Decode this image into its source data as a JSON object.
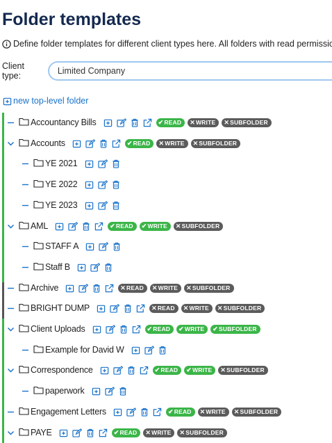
{
  "header": {
    "title": "Folder templates",
    "description": "Define folder templates for different client types here. All folders with read permissio"
  },
  "client_type": {
    "label": "Client type:",
    "value": "Limited Company"
  },
  "new_folder_label": "new top-level folder",
  "badge_labels": {
    "read": "READ",
    "write": "WRITE",
    "subfolder": "SUBFOLDER"
  },
  "colors": {
    "title": "#14294f",
    "link": "#1a73c9",
    "on": "#3bb548",
    "off": "#5b5b5b",
    "bar_accent": "#3bb548",
    "bar_dark": "#555555"
  },
  "folders": [
    {
      "name": "Accountancy Bills",
      "level": 0,
      "toggle": "dash",
      "perms": {
        "read": true,
        "write": false,
        "subfolder": false
      }
    },
    {
      "name": "Accounts",
      "level": 0,
      "toggle": "chevron",
      "perms": {
        "read": true,
        "write": false,
        "subfolder": false
      }
    },
    {
      "name": "YE 2021",
      "level": 1,
      "toggle": "dash"
    },
    {
      "name": "YE 2022",
      "level": 1,
      "toggle": "dash"
    },
    {
      "name": "YE 2023",
      "level": 1,
      "toggle": "dash"
    },
    {
      "name": "AML",
      "level": 0,
      "toggle": "chevron",
      "perms": {
        "read": true,
        "write": true,
        "subfolder": false
      }
    },
    {
      "name": "STAFF A",
      "level": 1,
      "toggle": "dash"
    },
    {
      "name": "Staff B",
      "level": 1,
      "toggle": "dash"
    },
    {
      "name": "Archive",
      "level": 0,
      "toggle": "dash",
      "perms": {
        "read": false,
        "write": false,
        "subfolder": false
      }
    },
    {
      "name": "BRIGHT DUMP",
      "level": 0,
      "toggle": "dash",
      "perms": {
        "read": false,
        "write": false,
        "subfolder": false
      }
    },
    {
      "name": "Client Uploads",
      "level": 0,
      "toggle": "chevron",
      "perms": {
        "read": true,
        "write": true,
        "subfolder": true
      }
    },
    {
      "name": "Example for David W",
      "level": 1,
      "toggle": "dash"
    },
    {
      "name": "Correspondence",
      "level": 0,
      "toggle": "chevron",
      "perms": {
        "read": true,
        "write": true,
        "subfolder": false
      }
    },
    {
      "name": "paperwork",
      "level": 1,
      "toggle": "dash"
    },
    {
      "name": "Engagement Letters",
      "level": 0,
      "toggle": "dash",
      "perms": {
        "read": true,
        "write": false,
        "subfolder": false
      }
    },
    {
      "name": "PAYE",
      "level": 0,
      "toggle": "chevron",
      "perms": {
        "read": true,
        "write": false,
        "subfolder": false
      }
    }
  ]
}
